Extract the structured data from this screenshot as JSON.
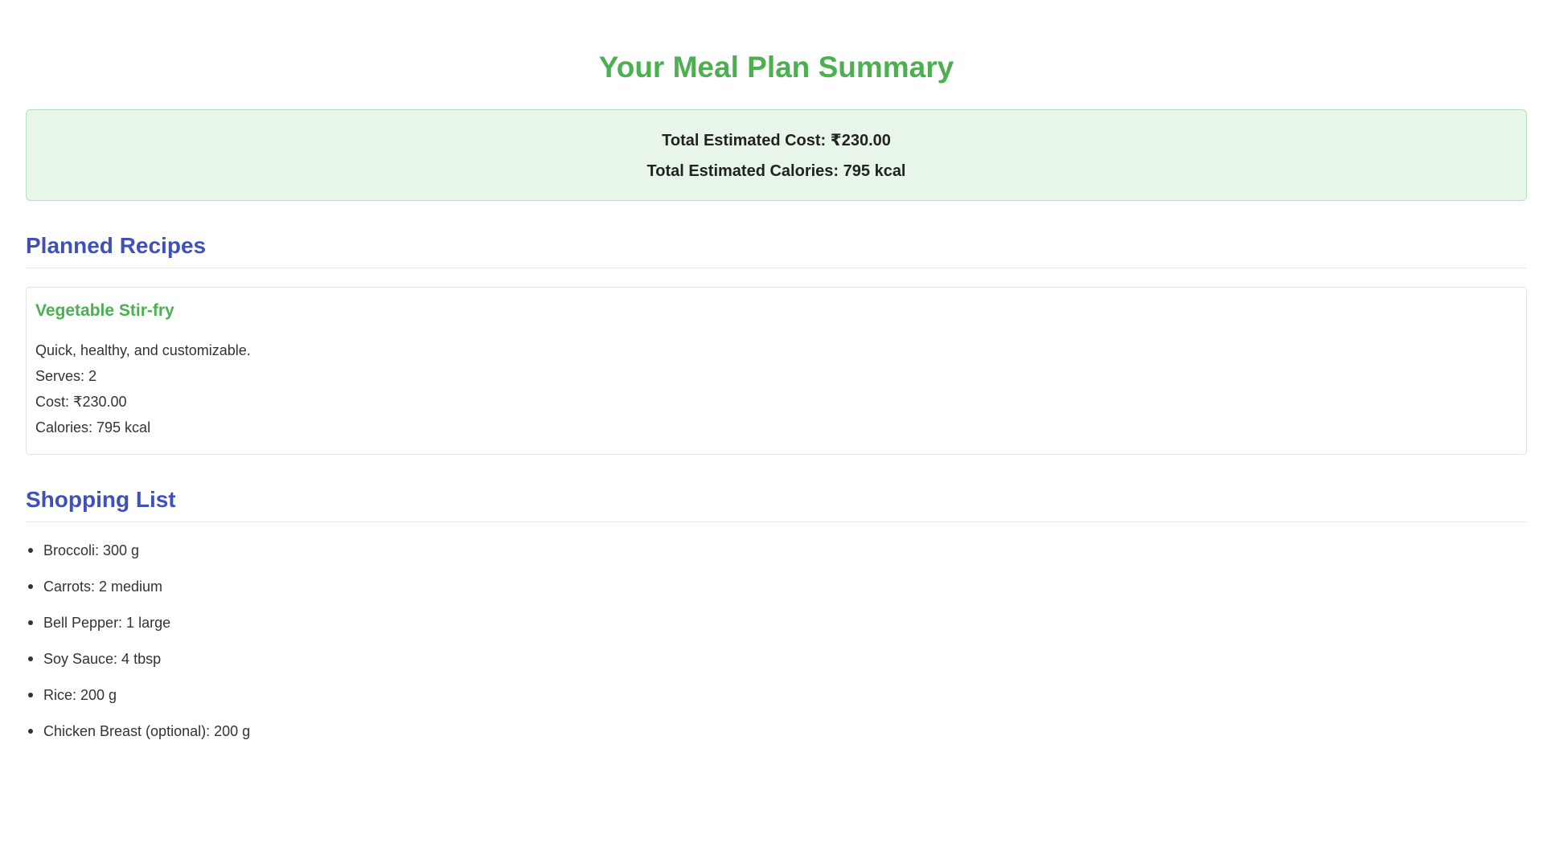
{
  "page": {
    "title": "Your Meal Plan Summary"
  },
  "totals": {
    "cost_label": "Total Estimated Cost:",
    "cost_value": "₹230.00",
    "calories_label": "Total Estimated Calories:",
    "calories_value": "795 kcal"
  },
  "recipes": {
    "heading": "Planned Recipes",
    "items": [
      {
        "name": "Vegetable Stir-fry",
        "description": "Quick, healthy, and customizable.",
        "serves": "Serves: 2",
        "cost": "Cost: ₹230.00",
        "calories": "Calories: 795 kcal"
      }
    ]
  },
  "shopping": {
    "heading": "Shopping List",
    "items": [
      "Broccoli: 300 g",
      "Carrots: 2 medium",
      "Bell Pepper: 1 large",
      "Soy Sauce: 4 tbsp",
      "Rice: 200 g",
      "Chicken Breast (optional): 200 g"
    ]
  },
  "colors": {
    "title_green": "#4caf50",
    "heading_blue": "#3f51b5",
    "totals_background": "#e8f5e9"
  }
}
